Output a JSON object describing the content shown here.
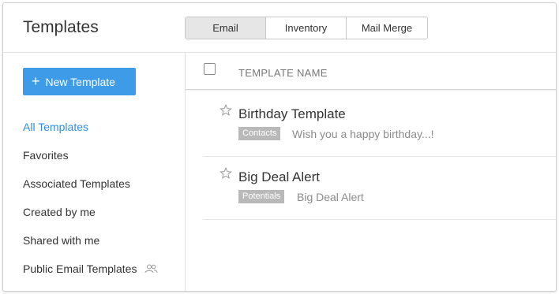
{
  "header": {
    "title": "Templates",
    "tabs": [
      {
        "label": "Email",
        "active": true
      },
      {
        "label": "Inventory",
        "active": false
      },
      {
        "label": "Mail Merge",
        "active": false
      }
    ]
  },
  "sidebar": {
    "new_button": {
      "icon": "plus-icon",
      "label": "New Template"
    },
    "items": [
      {
        "label": "All Templates",
        "active": true
      },
      {
        "label": "Favorites"
      },
      {
        "label": "Associated Templates"
      },
      {
        "label": "Created by me"
      },
      {
        "label": "Shared with me"
      },
      {
        "label": "Public Email Templates",
        "icon": "people-icon"
      }
    ]
  },
  "list": {
    "column_header": "TEMPLATE NAME",
    "rows": [
      {
        "title": "Birthday Template",
        "module": "Contacts",
        "subject": "Wish you a happy birthday...!",
        "starred": false
      },
      {
        "title": "Big Deal Alert",
        "module": "Potentials",
        "subject": "Big Deal Alert",
        "starred": false
      }
    ]
  },
  "colors": {
    "accent": "#3d9be8",
    "active_link": "#2f8ee0",
    "badge": "#b9b9b9",
    "active_tab": "#e6e6e6"
  }
}
